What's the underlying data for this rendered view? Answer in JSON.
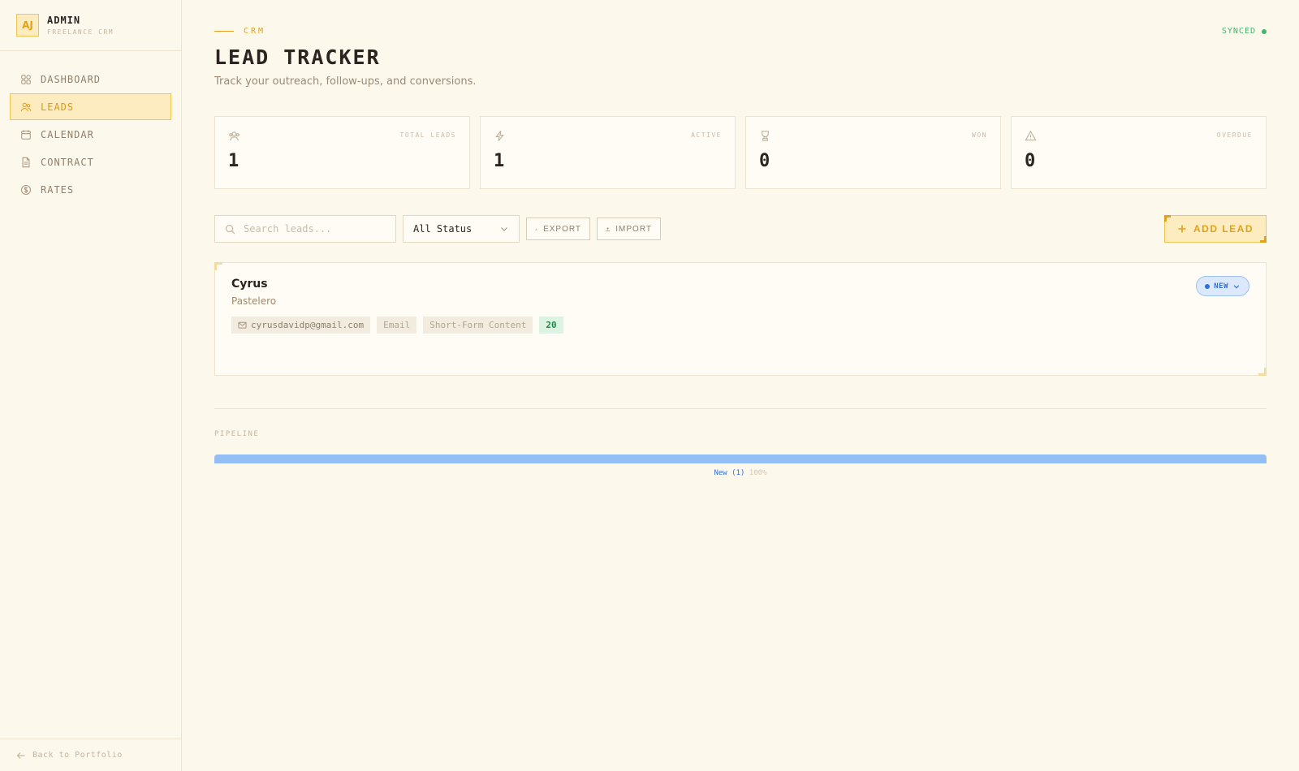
{
  "sidebar": {
    "avatar_initials": "AJ",
    "brand_name": "ADMIN",
    "brand_sub": "FREELANCE CRM",
    "items": [
      {
        "label": "DASHBOARD",
        "icon": "dashboard-icon"
      },
      {
        "label": "LEADS",
        "icon": "users-icon",
        "active": true
      },
      {
        "label": "CALENDAR",
        "icon": "calendar-icon"
      },
      {
        "label": "CONTRACT",
        "icon": "document-icon"
      },
      {
        "label": "RATES",
        "icon": "dollar-icon"
      }
    ],
    "back_label": "Back to Portfolio"
  },
  "header": {
    "eyebrow": "CRM",
    "sync_status": "SYNCED",
    "title": "LEAD TRACKER",
    "subtitle": "Track your outreach, follow-ups, and conversions."
  },
  "stats": [
    {
      "label": "TOTAL LEADS",
      "value": "1",
      "icon": "users-icon"
    },
    {
      "label": "ACTIVE",
      "value": "1",
      "icon": "lightning-icon"
    },
    {
      "label": "WON",
      "value": "0",
      "icon": "trophy-icon"
    },
    {
      "label": "OVERDUE",
      "value": "0",
      "icon": "warning-icon"
    }
  ],
  "toolbar": {
    "search_placeholder": "Search leads...",
    "status_filter": "All Status",
    "export_label": "EXPORT",
    "import_label": "IMPORT",
    "add_label": "ADD LEAD"
  },
  "leads": [
    {
      "name": "Cyrus",
      "role": "Pastelero",
      "email": "cyrusdavidp@gmail.com",
      "channel": "Email",
      "service": "Short-Form Content",
      "score": "20",
      "status": "NEW"
    }
  ],
  "pipeline": {
    "label": "PIPELINE",
    "segments": [
      {
        "name": "New",
        "count_label": "(1)",
        "percent": "100%",
        "fraction": 1.0,
        "color": "#93bff5"
      }
    ]
  },
  "colors": {
    "accent": "#e0a21a",
    "background": "#fdf8ec",
    "synced": "#3fb66e",
    "status_new": "#2f6fd8"
  }
}
